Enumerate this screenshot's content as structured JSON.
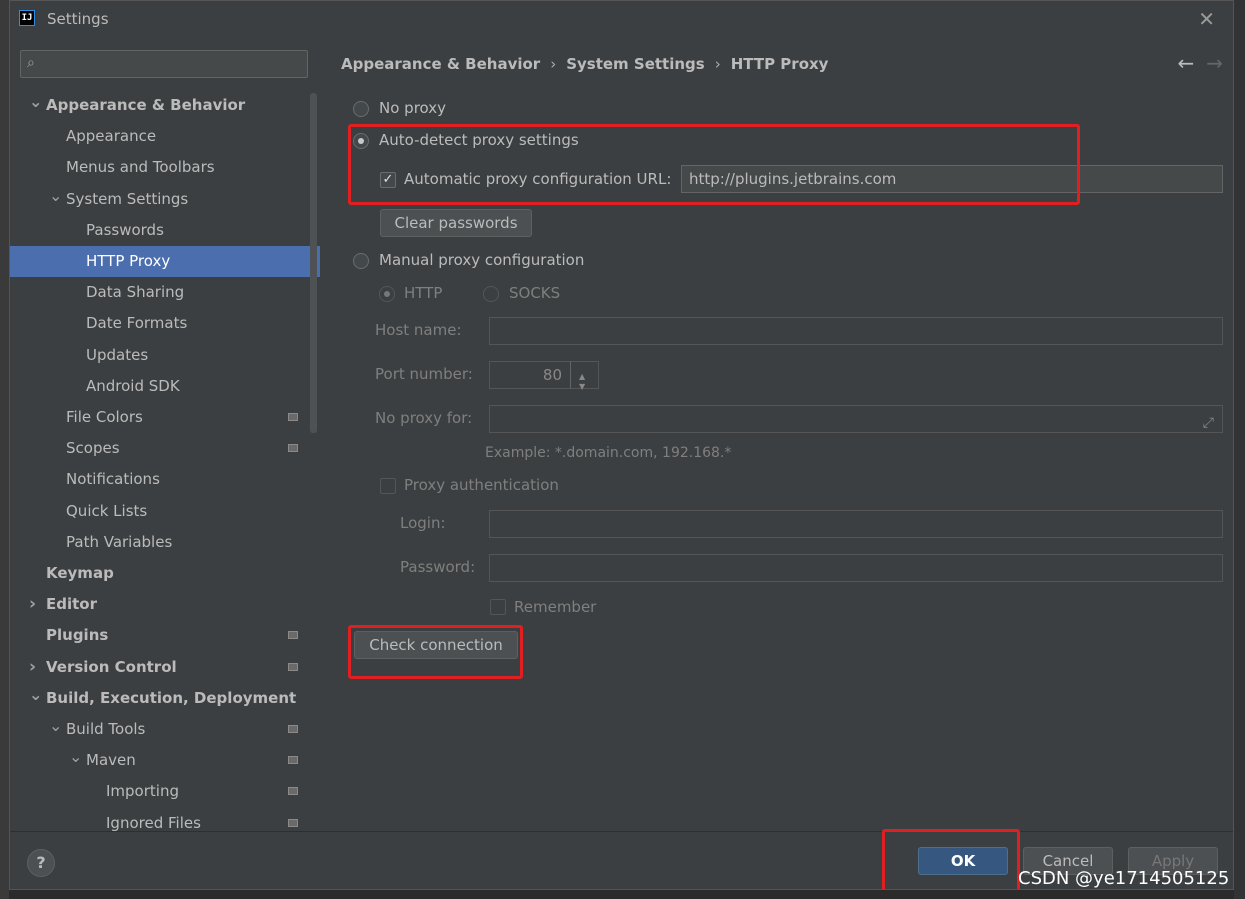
{
  "window": {
    "title": "Settings"
  },
  "sidebar": {
    "items": [
      {
        "label": "Appearance & Behavior",
        "level": 0,
        "bold": true,
        "arrow": "down"
      },
      {
        "label": "Appearance",
        "level": 1
      },
      {
        "label": "Menus and Toolbars",
        "level": 1
      },
      {
        "label": "System Settings",
        "level": 1,
        "arrow": "down"
      },
      {
        "label": "Passwords",
        "level": 2
      },
      {
        "label": "HTTP Proxy",
        "level": 2,
        "selected": true
      },
      {
        "label": "Data Sharing",
        "level": 2
      },
      {
        "label": "Date Formats",
        "level": 2
      },
      {
        "label": "Updates",
        "level": 2
      },
      {
        "label": "Android SDK",
        "level": 2
      },
      {
        "label": "File Colors",
        "level": 1,
        "icon": true
      },
      {
        "label": "Scopes",
        "level": 1,
        "icon": true
      },
      {
        "label": "Notifications",
        "level": 1
      },
      {
        "label": "Quick Lists",
        "level": 1
      },
      {
        "label": "Path Variables",
        "level": 1
      },
      {
        "label": "Keymap",
        "level": 0,
        "bold": true
      },
      {
        "label": "Editor",
        "level": 0,
        "bold": true,
        "arrow": "right"
      },
      {
        "label": "Plugins",
        "level": 0,
        "bold": true,
        "icon": true
      },
      {
        "label": "Version Control",
        "level": 0,
        "bold": true,
        "arrow": "right",
        "icon": true
      },
      {
        "label": "Build, Execution, Deployment",
        "level": 0,
        "bold": true,
        "arrow": "down"
      },
      {
        "label": "Build Tools",
        "level": 1,
        "arrow": "down",
        "icon": true
      },
      {
        "label": "Maven",
        "level": 2,
        "arrow": "down",
        "icon": true
      },
      {
        "label": "Importing",
        "level": 3,
        "icon": true
      },
      {
        "label": "Ignored Files",
        "level": 3,
        "icon": true
      }
    ]
  },
  "breadcrumb": [
    "Appearance & Behavior",
    "System Settings",
    "HTTP Proxy"
  ],
  "proxy": {
    "no_proxy": "No proxy",
    "auto_detect": "Auto-detect proxy settings",
    "auto_config_label": "Automatic proxy configuration URL:",
    "auto_config_url": "http://plugins.jetbrains.com",
    "clear_passwords": "Clear passwords",
    "manual": "Manual proxy configuration",
    "http": "HTTP",
    "socks": "SOCKS",
    "host_label": "Host name:",
    "host_value": "",
    "port_label": "Port number:",
    "port_value": "80",
    "no_proxy_for_label": "No proxy for:",
    "no_proxy_for_value": "",
    "example": "Example: *.domain.com, 192.168.*",
    "auth": "Proxy authentication",
    "login_label": "Login:",
    "password_label": "Password:",
    "remember": "Remember",
    "check_connection": "Check connection"
  },
  "footer": {
    "help": "?",
    "ok": "OK",
    "cancel": "Cancel",
    "apply": "Apply"
  },
  "watermark": "CSDN @ye1714505125"
}
